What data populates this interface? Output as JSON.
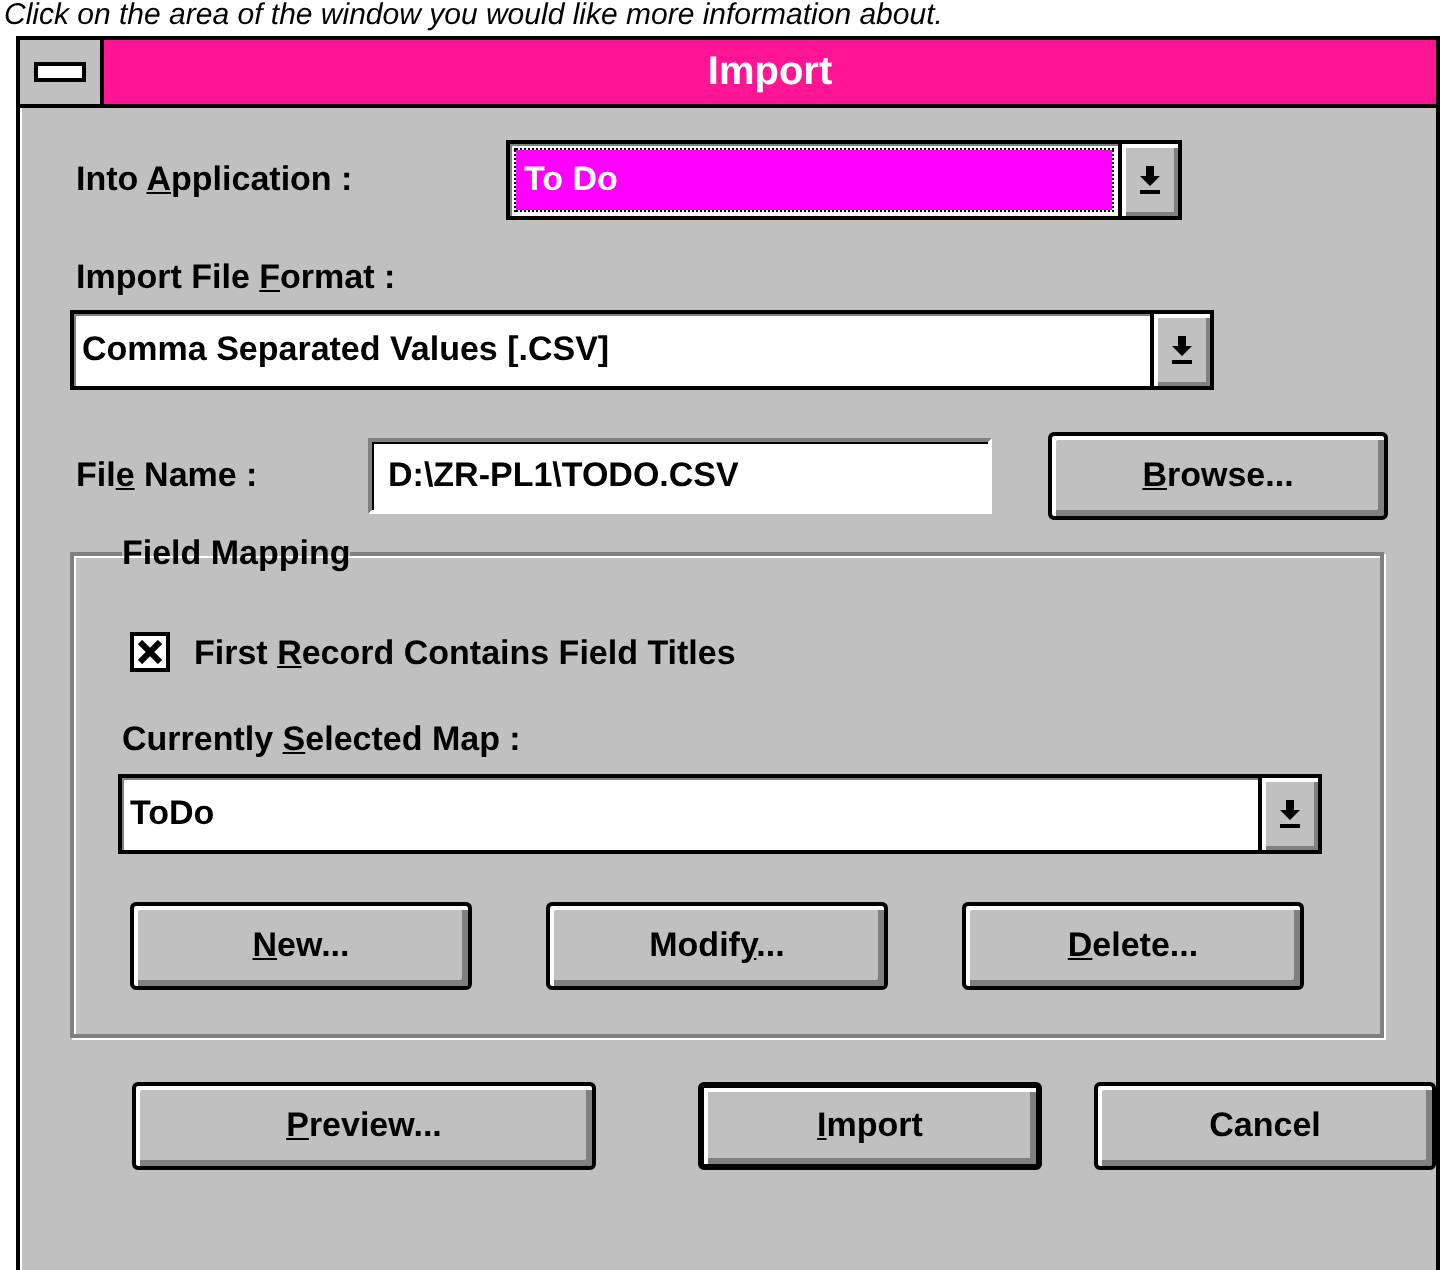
{
  "caption": "Click on the area of the window you would like more information about.",
  "window": {
    "title": "Import"
  },
  "into_application": {
    "label": {
      "pre": "Into ",
      "key": "A",
      "post": "pplication :"
    },
    "value": "To Do",
    "selected": true
  },
  "import_file_format": {
    "label": {
      "pre": "Import File ",
      "key": "F",
      "post": "ormat :"
    },
    "value": "Comma Separated Values [.CSV]",
    "selected": false
  },
  "file_name": {
    "label": {
      "pre": "Fil",
      "key": "e",
      "post": " Name :"
    },
    "value": "D:\\ZR-PL1\\TODO.CSV"
  },
  "browse_button": {
    "key": "B",
    "post": "rowse..."
  },
  "field_mapping": {
    "title": "Field Mapping",
    "first_record_checkbox": {
      "label": {
        "pre": "First ",
        "key": "R",
        "post": "ecord Contains Field Titles"
      },
      "checked": true
    },
    "selected_map": {
      "label": {
        "pre": "Currently ",
        "key": "S",
        "post": "elected Map :"
      },
      "value": "ToDo",
      "selected": false
    },
    "buttons": [
      {
        "label": {
          "key": "N",
          "post": "ew..."
        },
        "default": false
      },
      {
        "label": {
          "pre": "Modif",
          "key": "y",
          "post": "..."
        },
        "default": false
      },
      {
        "label": {
          "key": "D",
          "post": "elete..."
        },
        "default": false
      }
    ]
  },
  "buttons": [
    {
      "label": {
        "key": "P",
        "post": "review..."
      },
      "default": false
    },
    {
      "label": {
        "key": "I",
        "post": "mport"
      },
      "default": true
    },
    {
      "label": {
        "pre": "Cancel"
      },
      "default": false
    }
  ]
}
